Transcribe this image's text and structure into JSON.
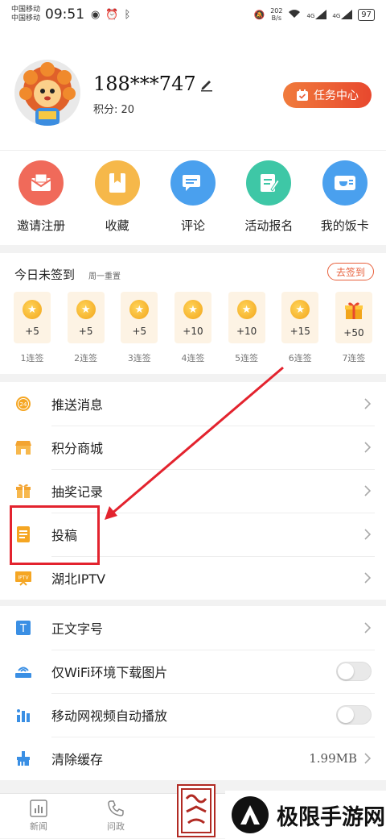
{
  "status_bar": {
    "carrier1": "中国移动",
    "carrier2": "中国移动",
    "time": "09:51",
    "net_speed_value": "202",
    "net_speed_unit": "B/s",
    "signal1": "4G",
    "signal2": "4G",
    "battery": "97"
  },
  "profile": {
    "username": "188***747",
    "points_label": "积分: 20",
    "task_center_label": "任务中心"
  },
  "quick_actions": [
    {
      "label": "邀请注册",
      "icon": "mail-icon",
      "color": "#f06a5a"
    },
    {
      "label": "收藏",
      "icon": "bookmark-icon",
      "color": "#f6b84a"
    },
    {
      "label": "评论",
      "icon": "comment-icon",
      "color": "#4aa0ee"
    },
    {
      "label": "活动报名",
      "icon": "signup-icon",
      "color": "#3ec7a6"
    },
    {
      "label": "我的饭卡",
      "icon": "meal-card-icon",
      "color": "#4aa0ee"
    }
  ],
  "checkin": {
    "title": "今日未签到",
    "subtitle": "周一重置",
    "button_label": "去签到",
    "days": [
      {
        "points": "+5",
        "label": "1连签"
      },
      {
        "points": "+5",
        "label": "2连签"
      },
      {
        "points": "+5",
        "label": "3连签"
      },
      {
        "points": "+10",
        "label": "4连签"
      },
      {
        "points": "+10",
        "label": "5连签"
      },
      {
        "points": "+15",
        "label": "6连签"
      },
      {
        "points": "+50",
        "label": "7连签"
      }
    ]
  },
  "menu1": [
    {
      "label": "推送消息",
      "icon": "push-24-icon"
    },
    {
      "label": "积分商城",
      "icon": "shop-icon"
    },
    {
      "label": "抽奖记录",
      "icon": "gift-icon"
    },
    {
      "label": "投稿",
      "icon": "submit-doc-icon"
    },
    {
      "label": "湖北IPTV",
      "icon": "iptv-icon",
      "icon_text": "IPTV"
    }
  ],
  "menu2": [
    {
      "label": "正文字号",
      "icon": "font-size-icon",
      "icon_text": "T"
    },
    {
      "label": "仅WiFi环境下载图片",
      "icon": "wifi-router-icon",
      "toggle": false
    },
    {
      "label": "移动网视频自动播放",
      "icon": "video-bars-icon",
      "toggle": false
    },
    {
      "label": "清除缓存",
      "icon": "broom-icon",
      "value": "1.99MB"
    }
  ],
  "bottom_nav": [
    {
      "label": "新闻",
      "icon": "news-chart-icon"
    },
    {
      "label": "问政",
      "icon": "phone-icon"
    }
  ],
  "watermark": {
    "text": "极限手游网"
  },
  "colors": {
    "accent": "#e8603c",
    "highlight": "#e3232e",
    "coin": "#f2a51b"
  }
}
